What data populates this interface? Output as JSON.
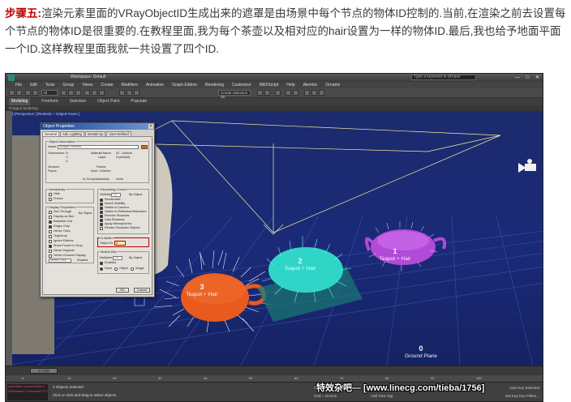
{
  "tutorial": {
    "step_label": "步骤五:",
    "text": "渲染元素里面的VRayObjectID生成出来的遮罩是由场景中每个节点的物体ID控制的.当前,在渲染之前去设置每个节点的物体ID是很重要的.在教程里面,我为每个茶壶以及相对应的hair设置为一样的物体ID.最后,我也给予地面平面一个ID.这样教程里面我就一共设置了四个ID."
  },
  "app": {
    "workspace": "Workspace: Default",
    "search_placeholder": "Type a keyword or phrase",
    "window_buttons": "— □ ✕",
    "menu": [
      "File",
      "Edit",
      "Tools",
      "Group",
      "Views",
      "Create",
      "Modifiers",
      "Animation",
      "Graph Editors",
      "Rendering",
      "Customize",
      "MAXScript",
      "Help",
      "Alembic",
      "Ornatrix"
    ],
    "toolbar_selset": "Create Selection Se",
    "view_dropdown": "All",
    "ribbon_tabs": [
      "Modeling",
      "Freeform",
      "Selection",
      "Object Paint",
      "Populate"
    ],
    "ribbon_sub": "Polygon Modeling",
    "viewport_label": "[+] [Perspective ] [Realistic + Edged Faces ]"
  },
  "scene": {
    "labels": [
      {
        "id": "1",
        "name": "Teapot + Hair"
      },
      {
        "id": "2",
        "name": "Teapot + Hair"
      },
      {
        "id": "3",
        "name": "Teapot + Hair"
      },
      {
        "id": "0",
        "name": "Ground Plane"
      }
    ],
    "colors": {
      "teapot1": "#b24ad8",
      "teapot2": "#2fd6c8",
      "teapot3": "#e85a1e",
      "hair": "#f4f4f4",
      "grid": "#5a7ad8"
    }
  },
  "dialog": {
    "title": "Object Properties",
    "tabs": [
      "General",
      "Adv. Lighting",
      "mental ray",
      "User Defined"
    ],
    "object_info_label": "Object Information",
    "name_label": "Name:",
    "name_value": "Multiple Selected",
    "dimensions_label": "Dimensions:",
    "dim_values": [
      "X:",
      "Y:",
      "Z:"
    ],
    "vertices_label": "Vertices:",
    "faces_label": "Faces:",
    "material_label": "Material Name:",
    "material_value": "02 - Default",
    "layer_label": "Layer:",
    "layer_value": "0 (default)",
    "parent_label": "Parent:",
    "num_children_label": "Num. Children:",
    "in_group_label": "In Group/Assembly:",
    "in_group_value": "None",
    "interactivity_label": "Interactivity",
    "interactivity_items": [
      "Hide",
      "Freeze"
    ],
    "display_props_label": "Display Properties",
    "display_items": [
      "See-Through",
      "Display as Box",
      "Backface Cull",
      "Edges Only",
      "Vertex Ticks",
      "Trajectory",
      "Ignore Extents",
      "Show Frozen in Gray",
      "Never Degrade",
      "Vertex Channel Display"
    ],
    "by_object": "By Object",
    "vertex_color": "Vertex Color",
    "shaded": "Shaded",
    "rendering_control_label": "Rendering Control",
    "visibility_label": "Visibility:",
    "visibility_value": "1.0",
    "render_items": [
      "Renderable",
      "Inherit Visibility",
      "Visible to Camera",
      "Visible to Reflection/Refraction",
      "Receive Shadows",
      "Cast Shadows",
      "Apply Atmospherics",
      "Render Occluded Objects"
    ],
    "gbuffer_label": "G-Buffer",
    "object_id_label": "Object ID:",
    "object_id_value": "2",
    "motion_blur_label": "Motion Blur",
    "multiplier_label": "Multiplier:",
    "multiplier_value": "1.0",
    "enabled_label": "Enabled",
    "blur_options": [
      "None",
      "Object",
      "Image"
    ],
    "ok": "OK",
    "cancel": "Cancel"
  },
  "timeline": {
    "slider_text": "0 / 100",
    "ticks": [
      "0",
      "10",
      "20",
      "30",
      "40",
      "50",
      "60",
      "70",
      "80",
      "90",
      "100"
    ]
  },
  "status": {
    "maxscript": [
      "actionMan.executeAction",
      "Submission Command:\"0\":\\"
    ],
    "selected": "2 Objects Selected",
    "prompt": "Click or click-and-drag to select objects",
    "coords": "X:   Y:   Z:",
    "grid": "Grid = 10.0cm",
    "time_tag": "Add Time Tag",
    "auto_key": "Auto Key   Selected",
    "set_key": "Set Key   Key Filters..."
  },
  "watermark": "特效杂吧— [www.linecg.com/tieba/1756]"
}
